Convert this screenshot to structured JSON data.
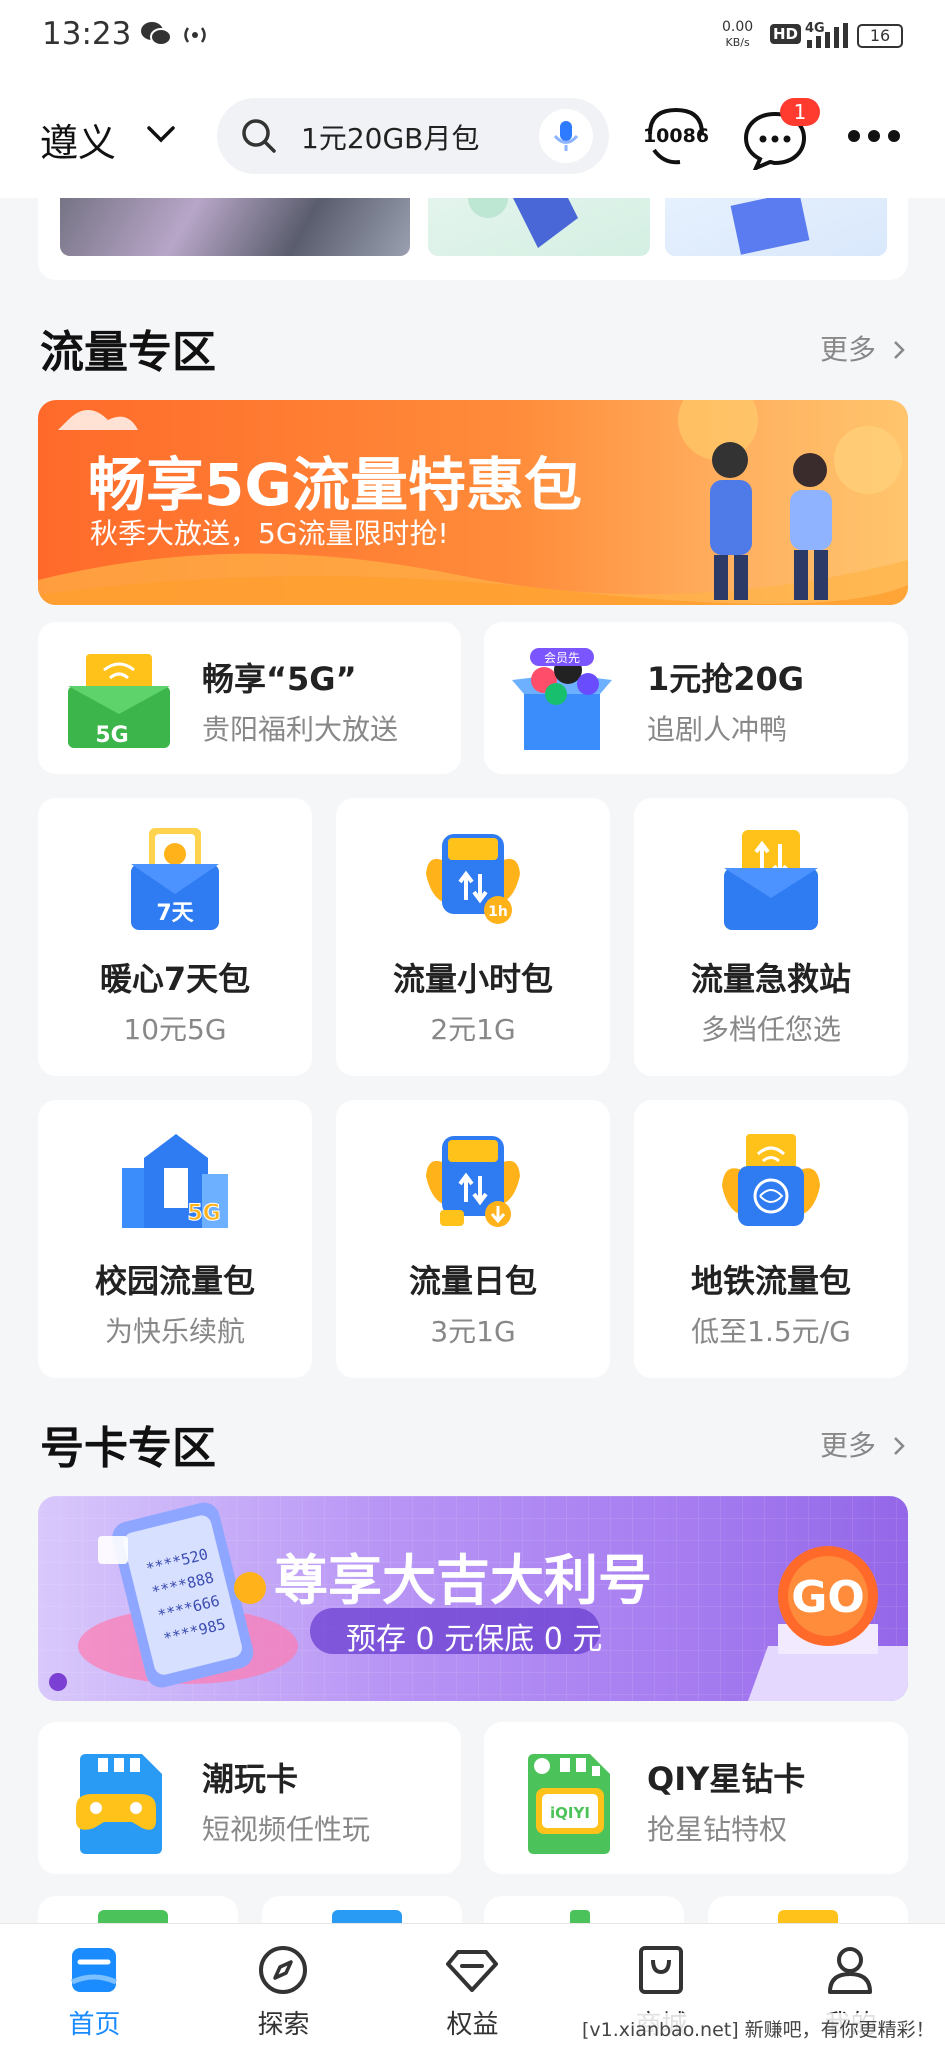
{
  "status_bar": {
    "time": "13:23",
    "speed_value": "0.00",
    "speed_unit": "KB/s",
    "hd_label": "HD",
    "network": "4G",
    "battery": "16"
  },
  "header": {
    "city": "遵义",
    "search_text": "1元20GB月包",
    "service_label": "10086",
    "message_badge": "1"
  },
  "traffic_section": {
    "title": "流量专区",
    "more_label": "更多",
    "banner_title": "畅享5G流量特惠包",
    "banner_subtitle": "秋季大放送，5G流量限时抢!",
    "promo_cards": [
      {
        "title": "畅享“5G”",
        "subtitle": "贵阳福利大放送",
        "icon_text": "5G"
      },
      {
        "title": "1元抢20G",
        "subtitle": "追剧人冲鸭",
        "icon_text": "会员先"
      }
    ],
    "tiles": [
      {
        "title": "暖心7天包",
        "subtitle": "10元5G",
        "icon_text": "7天"
      },
      {
        "title": "流量小时包",
        "subtitle": "2元1G",
        "icon_text": "1h"
      },
      {
        "title": "流量急救站",
        "subtitle": "多档任您选"
      },
      {
        "title": "校园流量包",
        "subtitle": "为快乐续航",
        "icon_text": "5G"
      },
      {
        "title": "流量日包",
        "subtitle": "3元1G"
      },
      {
        "title": "地铁流量包",
        "subtitle": "低至1.5元/G"
      }
    ]
  },
  "card_section": {
    "title": "号卡专区",
    "more_label": "更多",
    "banner_title": "尊享大吉大利号",
    "banner_subtitle": "预存 0 元保底 0 元",
    "banner_go": "GO",
    "phone_numbers": [
      "****520",
      "****888",
      "****666",
      "****985"
    ],
    "promo_cards": [
      {
        "title": "潮玩卡",
        "subtitle": "短视频任性玩"
      },
      {
        "title": "QIY星钻卡",
        "subtitle": "抢星钻特权",
        "icon_text": "iQIYI"
      }
    ]
  },
  "bottom_nav": [
    {
      "label": "首页",
      "icon": "home-icon",
      "active": true
    },
    {
      "label": "探索",
      "icon": "compass-icon",
      "active": false
    },
    {
      "label": "权益",
      "icon": "diamond-icon",
      "active": false
    },
    {
      "label": "商城",
      "icon": "bag-icon",
      "active": false
    },
    {
      "label": "我的",
      "icon": "user-icon",
      "active": false
    }
  ],
  "watermark": "[v1.xianbao.net] 新赚吧，有你更精彩！",
  "colors": {
    "accent": "#1a8cff",
    "badge": "#ff3b30",
    "traffic_banner": "#ff7a2f",
    "card_banner": "#a67cf0"
  }
}
